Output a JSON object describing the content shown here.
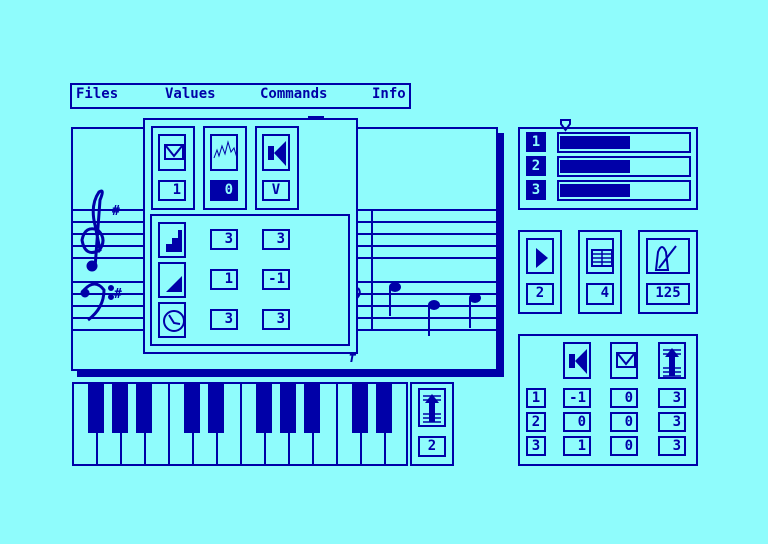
{
  "menu": {
    "items": [
      {
        "label": "Files"
      },
      {
        "label": "Values"
      },
      {
        "label": "Commands"
      },
      {
        "label": "Info"
      }
    ]
  },
  "colors": {
    "background": "#8ffcfc",
    "foreground": "#0000a8"
  },
  "score": {
    "dynamic_mark": "f",
    "clefs": [
      "treble-clef",
      "bass-clef"
    ],
    "key_signature": "#"
  },
  "popup": {
    "top": [
      {
        "icon": "envelope-icon",
        "value": "1"
      },
      {
        "icon": "waveform-icon",
        "value": "0"
      },
      {
        "icon": "speaker-icon",
        "value": "V"
      }
    ],
    "rows": [
      {
        "icon": "stairs-icon",
        "values": [
          "3",
          "3"
        ]
      },
      {
        "icon": "ramp-icon",
        "values": [
          "1",
          "-1"
        ]
      },
      {
        "icon": "clock-icon",
        "values": [
          "3",
          "3"
        ]
      }
    ]
  },
  "keyboard_button": {
    "icon": "transpose-icon",
    "value": "2"
  },
  "channels": [
    {
      "label": "1",
      "level": 0.55
    },
    {
      "label": "2",
      "level": 0.55
    },
    {
      "label": "3",
      "level": 0.55
    }
  ],
  "controls": [
    {
      "icon": "play-icon",
      "value": "2"
    },
    {
      "icon": "grid-icon",
      "value": "4"
    },
    {
      "icon": "metronome-icon",
      "value": "125"
    }
  ],
  "matrix": {
    "icons": [
      "speaker-icon",
      "envelope-icon",
      "transpose-icon"
    ],
    "rows": [
      {
        "label": "1",
        "values": [
          "-1",
          "0",
          "3"
        ]
      },
      {
        "label": "2",
        "values": [
          "0",
          "0",
          "3"
        ]
      },
      {
        "label": "3",
        "values": [
          "1",
          "0",
          "3"
        ]
      }
    ]
  }
}
